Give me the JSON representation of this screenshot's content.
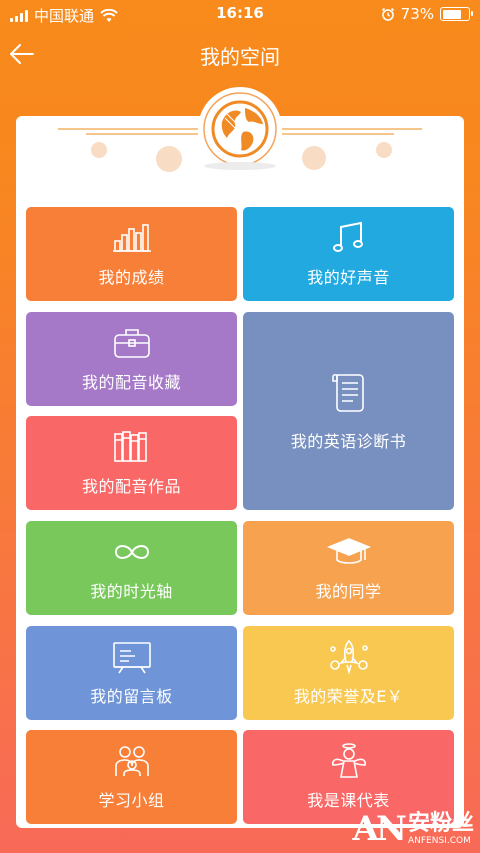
{
  "status_bar": {
    "carrier": "中国联通",
    "time": "16:16",
    "battery": "73%",
    "battery_level": 0.73,
    "icons": [
      "signal-icon",
      "wifi-icon",
      "alarm-icon",
      "battery-icon"
    ]
  },
  "nav": {
    "back_icon": "back-arrow-icon",
    "title": "我的空间"
  },
  "header_icon": "globe-icon",
  "tiles": [
    {
      "label": "我的成绩",
      "icon": "bar-chart-icon",
      "color": "#f77f38"
    },
    {
      "label": "我的好声音",
      "icon": "music-note-icon",
      "color": "#22aae0"
    },
    {
      "label": "我的配音收藏",
      "icon": "briefcase-icon",
      "color": "#a578c8"
    },
    {
      "label": "我的英语诊断书",
      "icon": "scroll-icon",
      "color": "#7890c0"
    },
    {
      "label": "我的配音作品",
      "icon": "books-icon",
      "color": "#f96766"
    },
    {
      "label": "我的时光轴",
      "icon": "infinity-icon",
      "color": "#78c85c"
    },
    {
      "label": "我的同学",
      "icon": "graduation-cap-icon",
      "color": "#f7a24e"
    },
    {
      "label": "我的留言板",
      "icon": "chalkboard-icon",
      "color": "#6f95d8"
    },
    {
      "label": "我的荣誉及E￥",
      "icon": "rocket-icon",
      "color": "#f8c850"
    },
    {
      "label": "学习小组",
      "icon": "group-icon",
      "color": "#f77f38"
    },
    {
      "label": "我是课代表",
      "icon": "angel-icon",
      "color": "#f96766"
    }
  ],
  "watermark": {
    "logo": "AN",
    "name": "安粉丝",
    "domain": "ANFENSI.COM"
  }
}
